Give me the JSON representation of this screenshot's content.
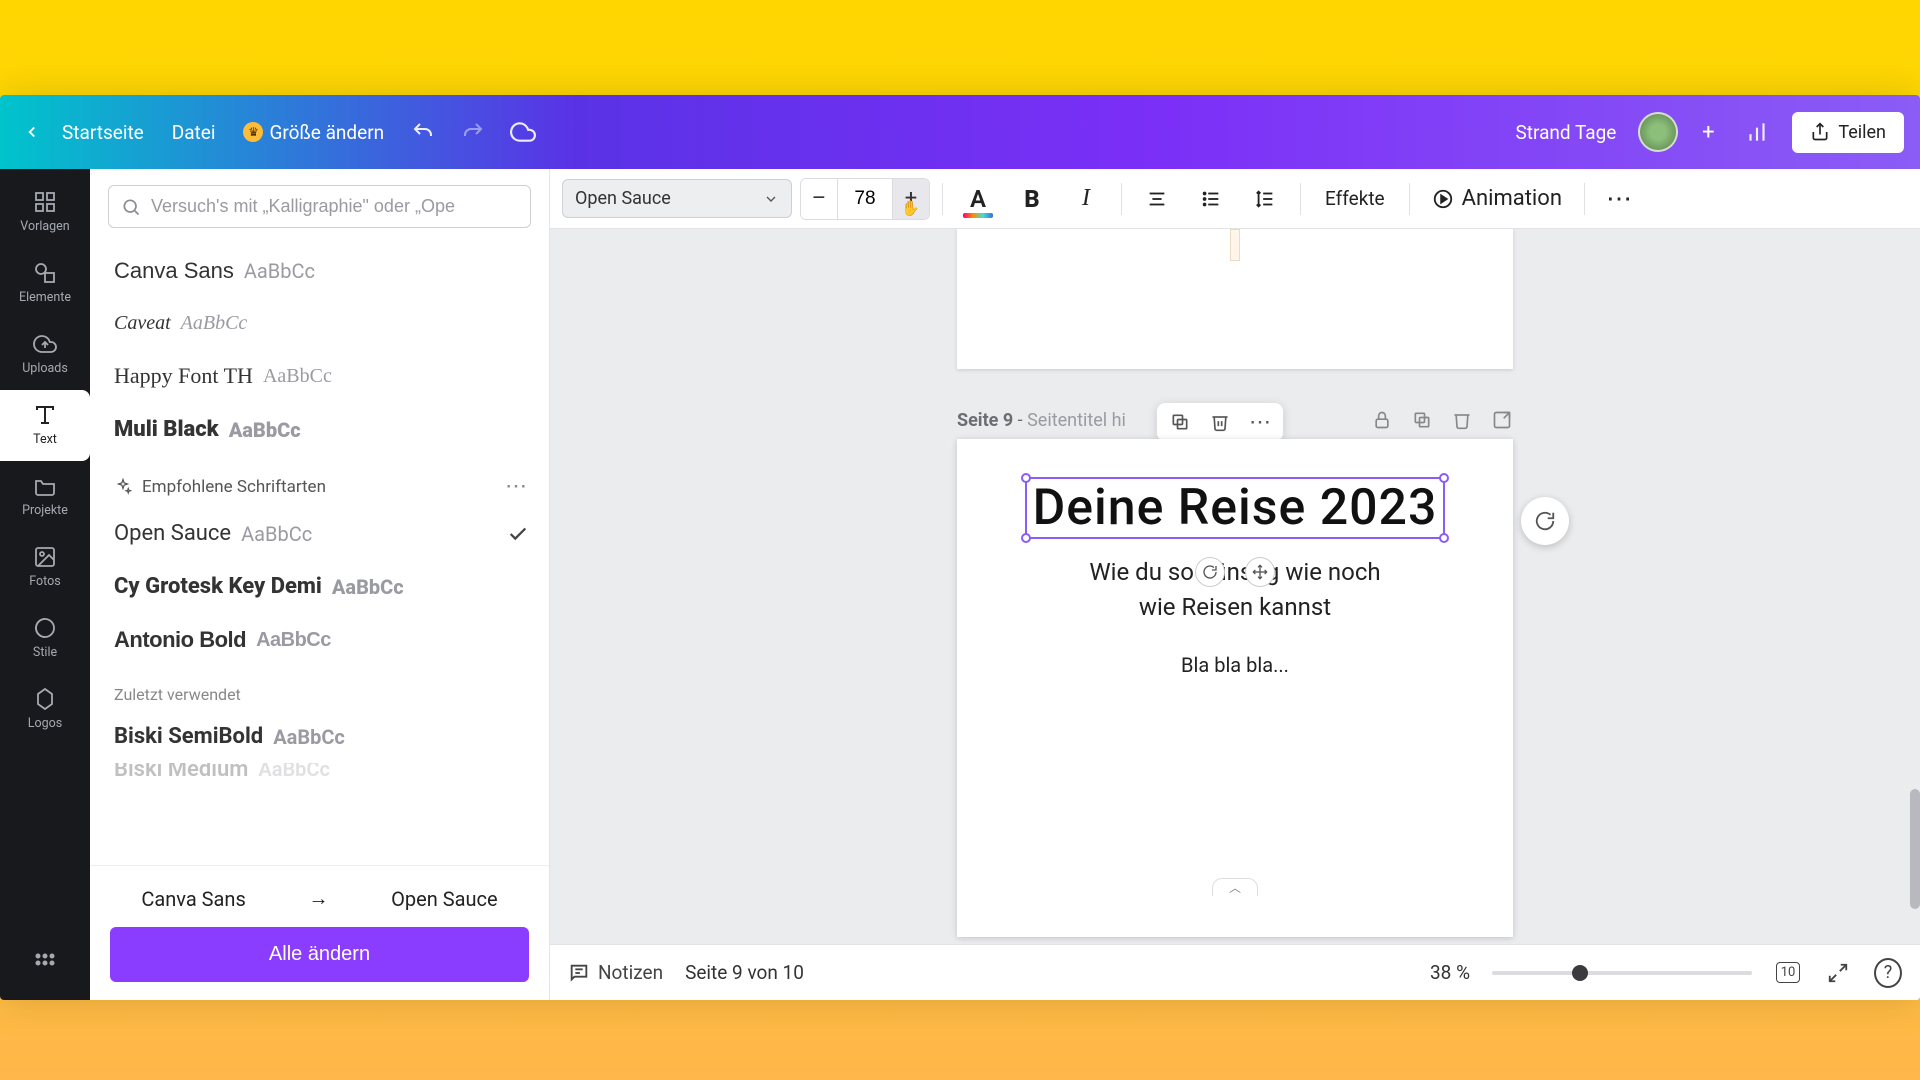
{
  "topbar": {
    "home": "Startseite",
    "file": "Datei",
    "resize": "Größe ändern",
    "project_name": "Strand Tage",
    "share": "Teilen"
  },
  "nav": {
    "templates": "Vorlagen",
    "elements": "Elemente",
    "uploads": "Uploads",
    "text": "Text",
    "projects": "Projekte",
    "photos": "Fotos",
    "styles": "Stile",
    "logos": "Logos"
  },
  "fontsPanel": {
    "search_placeholder": "Versuch's mit „Kalligraphie\" oder „Ope",
    "sample": "AaBbCc",
    "list_top": [
      "Canva Sans",
      "Caveat",
      "Happy Font TH",
      "Muli Black"
    ],
    "recommended_label": "Empfohlene Schriftarten",
    "recommended": [
      "Open Sauce",
      "Cy Grotesk Key Demi",
      "Antonio Bold"
    ],
    "recent_label": "Zuletzt verwendet",
    "recent": [
      "Biski SemiBold",
      "Biski Medium"
    ],
    "change_from": "Canva Sans",
    "change_to": "Open Sauce",
    "change_all": "Alle ändern"
  },
  "textToolbar": {
    "font_name": "Open Sauce",
    "font_size": "78",
    "effects": "Effekte",
    "animation": "Animation"
  },
  "canvas": {
    "page_label": "Seite 9",
    "page_title_placeholder": "Seitentitel hi",
    "title": "Deine Reise 2023",
    "subtitle_l1": "Wie du so günstig wie noch",
    "subtitle_l2": "wie Reisen kannst",
    "body": "Bla bla bla..."
  },
  "statusbar": {
    "notes": "Notizen",
    "page_of": "Seite 9 von 10",
    "zoom": "38 %",
    "grid_count": "10"
  }
}
